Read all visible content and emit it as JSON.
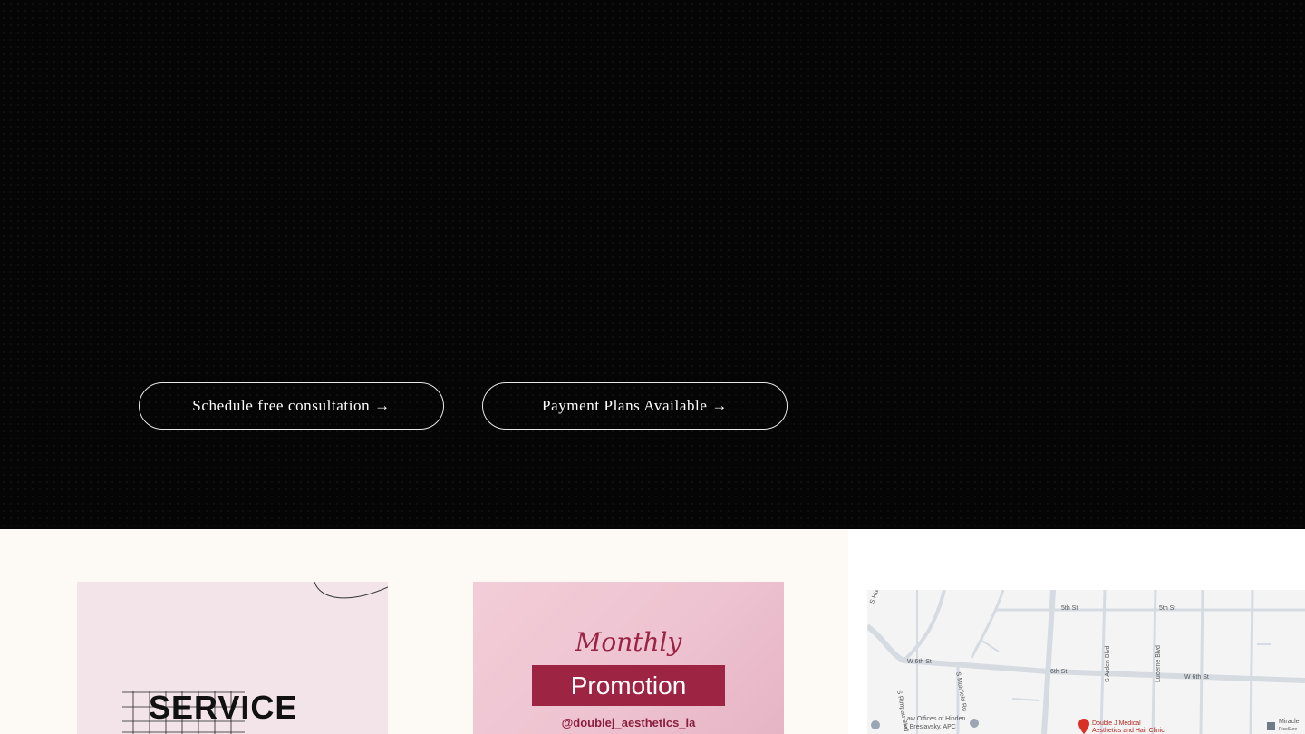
{
  "hero": {
    "buttons": [
      {
        "label": "Schedule free consultation →"
      },
      {
        "label": "Payment Plans Available →"
      }
    ]
  },
  "cards": {
    "service": {
      "title": "SERVICE"
    },
    "promotion": {
      "script_title": "Monthly",
      "title": "Promotion",
      "handle": "@doublej_aesthetics_la"
    }
  },
  "map": {
    "streets": {
      "s_hudson": "S Hudson",
      "fifth_st_a": "5th St",
      "fifth_st_b": "5th St",
      "w_sixth_st_a": "W 6th St",
      "sixth_st": "6th St",
      "w_sixth_st_b": "W 6th St",
      "s_rimpau": "S Rimpau Blvd",
      "s_muirfield": "S Muirfield Rd",
      "s_arden": "S Arden Blvd",
      "lucerne": "Lucerne Blvd"
    },
    "places": {
      "law_office_line1": "Law Offices of Hinden",
      "law_office_line2": "& Breslavsky, APC",
      "clinic_line1": "Double J Medical",
      "clinic_line2": "Aesthetics and Hair Clinic",
      "miracle": "Miracle",
      "pico_sure": "PicoSure"
    },
    "colors": {
      "road": "#d6dbe2",
      "pin": "#d93025"
    }
  }
}
